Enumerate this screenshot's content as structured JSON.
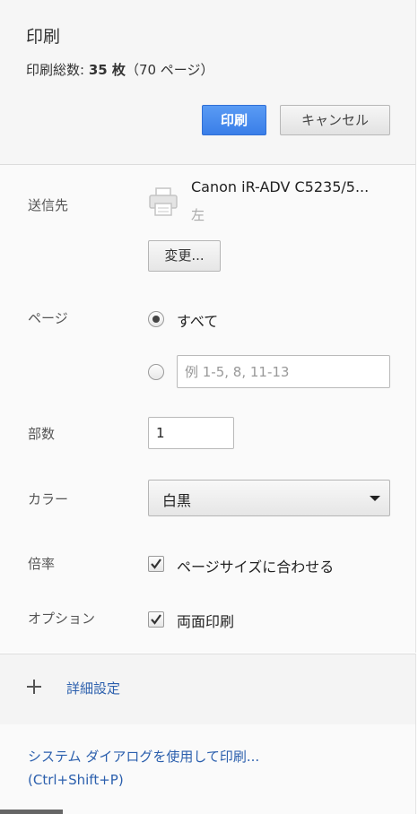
{
  "header": {
    "title": "印刷",
    "summary_prefix": "印刷総数: ",
    "summary_count": "35 枚",
    "summary_suffix": "（70 ページ）",
    "print_button": "印刷",
    "cancel_button": "キャンセル"
  },
  "destination": {
    "label": "送信先",
    "printer_name": "Canon iR-ADV C5235/5...",
    "printer_location": "左",
    "change_button": "変更...",
    "icon": "printer-icon"
  },
  "pages": {
    "label": "ページ",
    "all_option": "すべて",
    "all_selected": true,
    "custom_placeholder": "例 1-5, 8, 11-13",
    "custom_value": ""
  },
  "copies": {
    "label": "部数",
    "value": "1"
  },
  "color": {
    "label": "カラー",
    "selected": "白黒"
  },
  "scale": {
    "label": "倍率",
    "option": "ページサイズに合わせる",
    "checked": true
  },
  "options": {
    "label": "オプション",
    "option": "両面印刷",
    "checked": true
  },
  "advanced": {
    "label": "詳細設定",
    "icon": "plus-icon"
  },
  "footer": {
    "system_dialog_link": "システム ダイアログを使用して印刷...",
    "shortcut": "(Ctrl+Shift+P)"
  },
  "colors": {
    "accent": "#3a7ee8",
    "link": "#2b5fad"
  }
}
